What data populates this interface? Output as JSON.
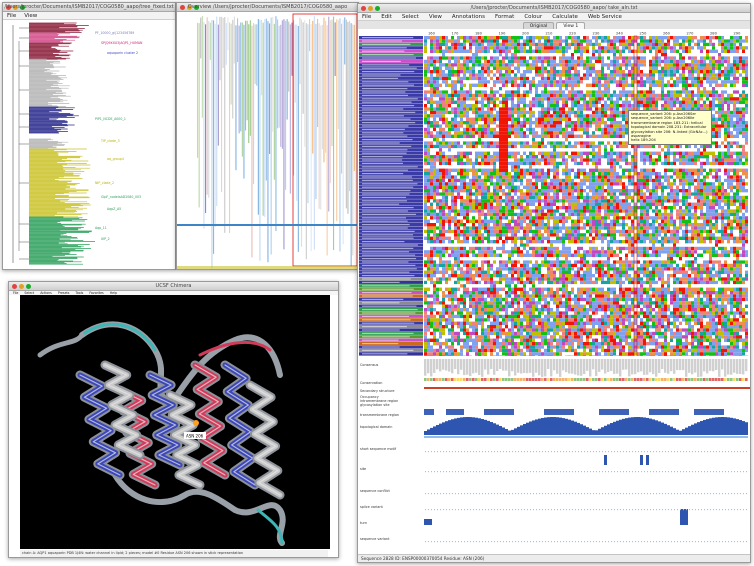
{
  "tree_window": {
    "title": "/Users/jprocter/Documents/ISMB2017/COG0580_aapo/tree_fixed.txt",
    "menu": [
      "File",
      "View"
    ],
    "clade_labels": [
      {
        "text": "PF_10000_gi|123456789",
        "color": "#7a7ab8"
      },
      {
        "text": "SP|Q9XXX3|AQP1_HUMAN",
        "color": "#c81e6b"
      },
      {
        "text": "aquaporin cluster 2",
        "color": "#3b46c4"
      },
      {
        "text": "PIP1_NCDE_A000_1",
        "color": "#2ea05c"
      },
      {
        "text": "TIP_clade_3",
        "color": "#b9b000"
      },
      {
        "text": "aq_group4",
        "color": "#b9b000"
      },
      {
        "text": "NIP_clade_2",
        "color": "#b9b000"
      },
      {
        "text": "GlpF_nodelaAD2080_003",
        "color": "#2ea05c"
      },
      {
        "text": "AqpZ_A5",
        "color": "#2ea05c"
      },
      {
        "text": "Aqp_11",
        "color": "#2ea05c"
      },
      {
        "text": "XIP_2",
        "color": "#2ea05c"
      }
    ],
    "colors": {
      "maroon": "#8a1d3a",
      "grey": "#b4b4b4",
      "navy": "#2a2a8c",
      "olive": "#c9c22a",
      "green": "#2ea05c",
      "pink": "#d44a8a"
    }
  },
  "overview_window": {
    "title": "Overview /Users/jprocter/Documents/ISMB2017/COG0580_aapo"
  },
  "chimera_window": {
    "title": "UCSF Chimera",
    "menu": [
      "File",
      "Select",
      "Actions",
      "Presets",
      "Tools",
      "Favorites",
      "Help"
    ],
    "status": "chain A: AQP1 aquaporin PDB 1J4N: water channel in lipid; 2 pieces; model #0 Residue ASN 206 shown in stick representation"
  },
  "jalview": {
    "title": "/Users/jprocter/Documents/ISMB2017/COG0580_aapo/ take_aln.txt",
    "menu": [
      "File",
      "Edit",
      "Select",
      "View",
      "Annotations",
      "Format",
      "Colour",
      "Calculate",
      "Web Service"
    ],
    "tabs": [
      "Original",
      "View 1"
    ],
    "active_tab": "Original",
    "ruler": [
      "160",
      "170",
      "180",
      "190",
      "200",
      "210",
      "220",
      "230",
      "240",
      "250",
      "260",
      "270",
      "280",
      "290"
    ],
    "tooltip": [
      "sequence_variant 206: p.Asn206Ser",
      "sequence_variant 206: p.Asn206Ile",
      "transmembrane region 183-211: helical",
      "topological domain 208-231: Extracellular",
      "glycosylation site 206: N-linked (GlcNAc...) asparagine",
      "helix 189-204"
    ],
    "annotations": [
      "Consensus",
      "Conservation",
      "Secondary structure",
      "Occupancy",
      "intramembrane region",
      "glycosylation site",
      "transmembrane region",
      "topological domain",
      "short sequence motif",
      "site",
      "sequence conflict",
      "splice variant",
      "turn",
      "sequence variant"
    ],
    "status": "Sequence 2828 ID: ENSP00000370054 Residue: ASN (206)"
  }
}
